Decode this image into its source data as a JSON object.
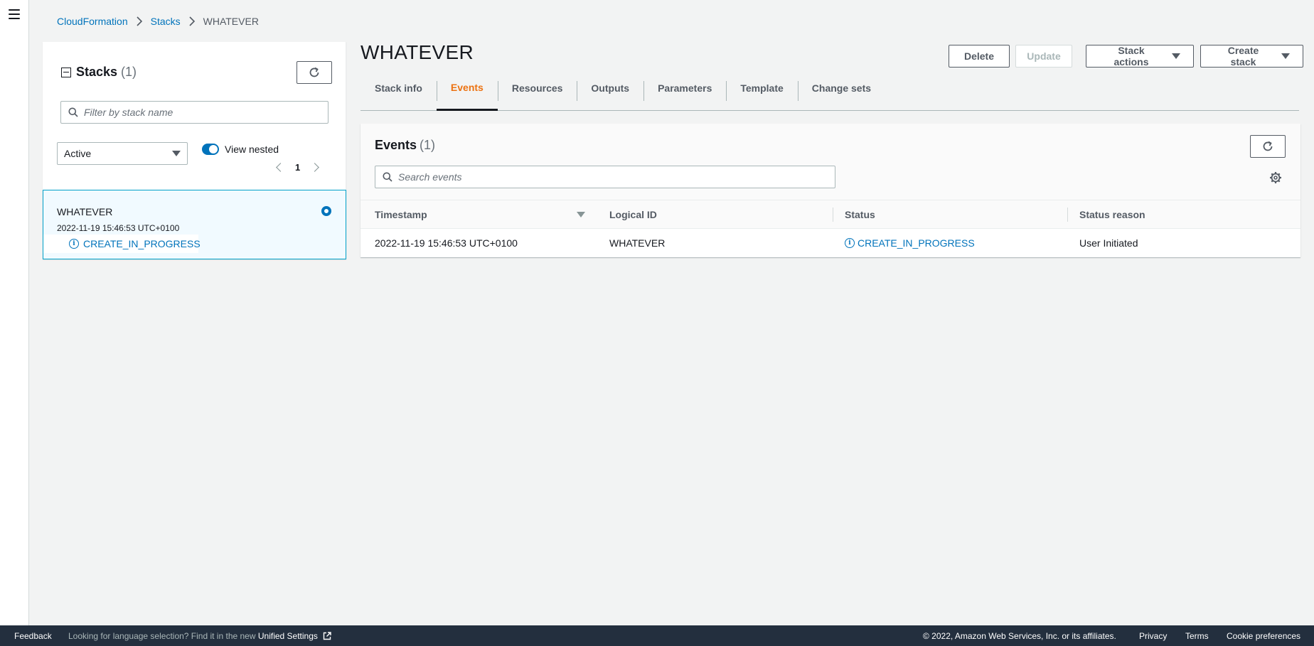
{
  "breadcrumb": {
    "items": [
      "CloudFormation",
      "Stacks"
    ],
    "current": "WHATEVER"
  },
  "stacks_panel": {
    "title": "Stacks",
    "count": "(1)",
    "search_placeholder": "Filter by stack name",
    "filter_value": "Active",
    "toggle_label": "View nested",
    "page": "1",
    "stack": {
      "name": "WHATEVER",
      "timestamp": "2022-11-19 15:46:53 UTC+0100",
      "status": "CREATE_IN_PROGRESS"
    }
  },
  "page_title": "WHATEVER",
  "actions": {
    "delete": "Delete",
    "update": "Update",
    "stack_actions": "Stack actions",
    "create_stack": "Create stack"
  },
  "tabs": [
    "Stack info",
    "Events",
    "Resources",
    "Outputs",
    "Parameters",
    "Template",
    "Change sets"
  ],
  "active_tab": "Events",
  "events": {
    "title": "Events",
    "count": "(1)",
    "search_placeholder": "Search events",
    "columns": [
      "Timestamp",
      "Logical ID",
      "Status",
      "Status reason"
    ],
    "rows": [
      {
        "timestamp": "2022-11-19 15:46:53 UTC+0100",
        "logical_id": "WHATEVER",
        "status": "CREATE_IN_PROGRESS",
        "status_reason": "User Initiated"
      }
    ]
  },
  "footer": {
    "feedback": "Feedback",
    "lang_prefix": "Looking for language selection? Find it in the new",
    "lang_link": "Unified Settings",
    "copyright": "© 2022, Amazon Web Services, Inc. or its affiliates.",
    "privacy": "Privacy",
    "terms": "Terms",
    "cookies": "Cookie preferences"
  },
  "colors": {
    "link": "#0073bb",
    "active_tab": "#ec7211",
    "footer_bg": "#232f3e",
    "selected_card_bg": "#f1faff",
    "selected_card_border": "#00a1c9"
  },
  "icons": [
    "menu-icon",
    "chevron-right-icon",
    "collapse-icon",
    "refresh-icon",
    "search-icon",
    "caret-down-icon",
    "toggle-icon",
    "chevron-left-icon",
    "radio-selected-icon",
    "info-icon",
    "gear-icon",
    "sort-descending-icon",
    "external-link-icon"
  ]
}
